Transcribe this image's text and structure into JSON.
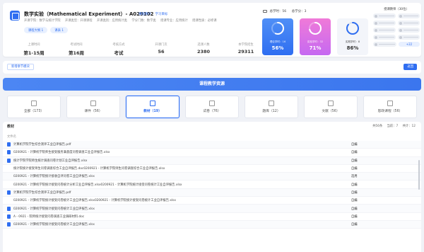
{
  "course": {
    "title": "数学实验（Mathematical Experiment）- A029102",
    "links": [
      "课程简介",
      "学习目标"
    ],
    "meta": [
      "开课学院：数学与统计学院",
      "开课类型：开课课程",
      "开课类别：应用统计类",
      "学分门数：数学类",
      "授课专业：应用统计",
      "授课性质：必修课"
    ],
    "tags": [
      "课程大纲 1",
      "课表 1"
    ]
  },
  "stats": [
    {
      "label": "上课时间",
      "value": "第1-15周"
    },
    {
      "label": "考试时间",
      "value": "第16周"
    },
    {
      "label": "考核方式",
      "value": "考试"
    },
    {
      "label": "开课门次",
      "value": "56"
    },
    {
      "label": "选课人数",
      "value": "2380"
    },
    {
      "label": "本学院招生",
      "value": "29311"
    }
  ],
  "totals": {
    "total_hours": "总学时：56",
    "total_credits": "总学分：3"
  },
  "rings": [
    {
      "label": "理论学时：16",
      "percent": "56%",
      "fraction": 0.56
    },
    {
      "label": "实验学时：32",
      "percent": "71%",
      "fraction": 0.71
    },
    {
      "label": "实践学时：8",
      "percent": "86%",
      "fraction": 0.86
    }
  ],
  "teachers": {
    "title": "授课教师（30位）",
    "more": "+22"
  },
  "toolbar": {
    "new_chapter": "新增章节模块",
    "back": "返回"
  },
  "banner": "课程教学资源",
  "categories": [
    {
      "label": "全部（173）",
      "icon": "grid-icon"
    },
    {
      "label": "课件（56）",
      "icon": "slides-icon"
    },
    {
      "label": "教材（19）",
      "icon": "book-icon"
    },
    {
      "label": "试卷（76）",
      "icon": "paper-icon"
    },
    {
      "label": "题库（12）",
      "icon": "bank-icon"
    },
    {
      "label": "文献（56）",
      "icon": "doc-icon"
    },
    {
      "label": "思政课程（56）",
      "icon": "flag-icon"
    }
  ],
  "table": {
    "head": "教材",
    "summary": [
      "共56条",
      "当前：7",
      "共计：12"
    ],
    "column": "文件名",
    "rows": [
      {
        "name": "计算机学院学生综合测评工业自评报告.pdf",
        "action": "自编",
        "icon": true
      },
      {
        "name": "0200921 - 计算机学院师生接受服务满意度问卷调查工业自评报告.xlsx",
        "action": "自编",
        "icon": true
      },
      {
        "name": "统计学院学院师生统计调查问卷计划工业自评报告.xlsx",
        "action": "自编",
        "icon": true
      },
      {
        "name": "统计院统计接受师生问卷调查综合工业自评报告.doc0200921 - 计算机学院师生问卷调查综合工业自评报告.xlsx",
        "action": "自编",
        "icon": false
      },
      {
        "name": "0200921 - 计算机学院统计接收自评问卷工业自评报告.xlsx",
        "action": "选用",
        "icon": false
      },
      {
        "name": "0200921 - 计算机学院统计接受问卷统计分析工业自评报告.xlsx0200921 - 计算机学院统计接受问卷统计工业自评报告.xlsx",
        "action": "自编",
        "icon": false
      },
      {
        "name": "计算机学院学生综合测评工业自评报告.pdf",
        "action": "自编",
        "icon": true
      },
      {
        "name": "0200921 - 计算机学院统计接受问卷统计工业自评报告.xlsx0200921 - 计算机学院统计接受问卷统计工业自评报告.xlsx",
        "action": "自编",
        "icon": false
      },
      {
        "name": "0200921 - 计算机学院统计接受问卷统计工业自评报告.xlsx",
        "action": "自编",
        "icon": true
      },
      {
        "name": "A - 0921 - 院师统计接受问卷调查工业调研材料.doc",
        "action": "自编",
        "icon": true
      },
      {
        "name": "0200921 - 计算机学院统计接受问卷统计工业自评报告.xlsx",
        "action": "自编",
        "icon": true
      }
    ]
  },
  "colors": {
    "accent": "#2f6ef1",
    "pink": "#d96cf0"
  }
}
